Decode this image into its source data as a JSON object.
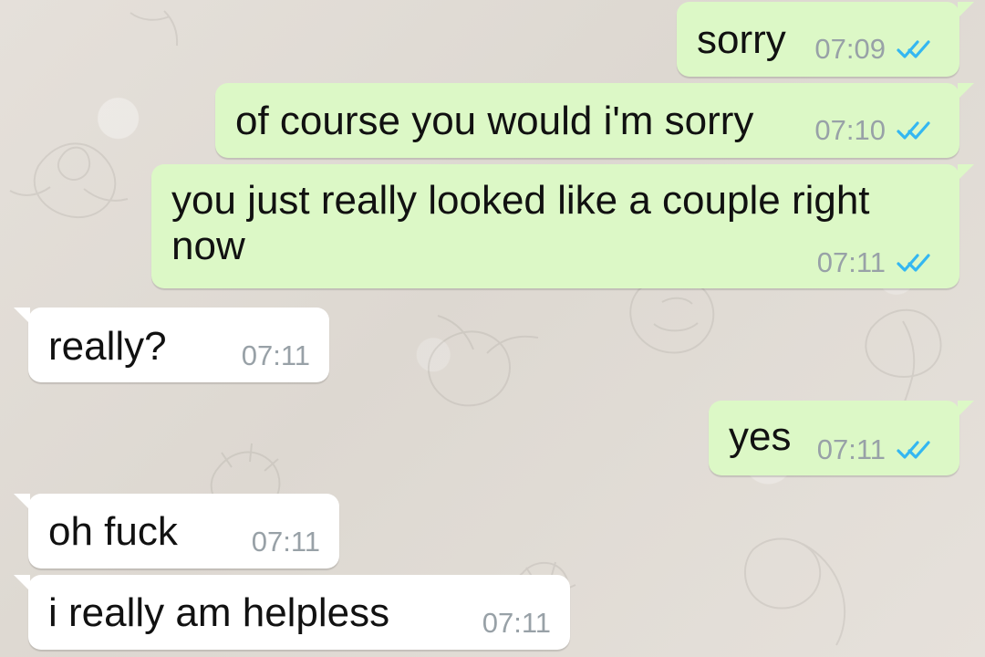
{
  "theme": {
    "background": "#e3dfda",
    "outgoing_bubble": "#dcf8c6",
    "incoming_bubble": "#ffffff",
    "timestamp": "#98a1a7",
    "read_ticks": "#34b7f1"
  },
  "messages": [
    {
      "direction": "outgoing",
      "text": "sorry",
      "time": "07:09",
      "status_icon": "double-check-read-icon"
    },
    {
      "direction": "outgoing",
      "text": "of course you would i'm sorry",
      "time": "07:10",
      "status_icon": "double-check-read-icon"
    },
    {
      "direction": "outgoing",
      "text": "you just really looked like a couple right now",
      "time": "07:11",
      "status_icon": "double-check-read-icon"
    },
    {
      "direction": "incoming",
      "text": "really?",
      "time": "07:11"
    },
    {
      "direction": "outgoing",
      "text": "yes",
      "time": "07:11",
      "status_icon": "double-check-read-icon"
    },
    {
      "direction": "incoming",
      "text": "oh fuck",
      "time": "07:11"
    },
    {
      "direction": "incoming",
      "text": "i really am helpless",
      "time": "07:11"
    }
  ]
}
